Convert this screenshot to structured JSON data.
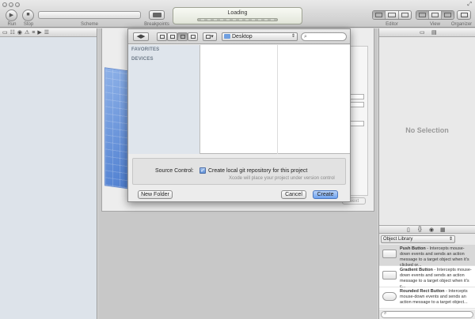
{
  "toolbar": {
    "run_label": "Run",
    "stop_label": "Stop",
    "scheme_label": "Scheme",
    "breakpoints_label": "Breakpoints",
    "activity_title": "Loading",
    "editor_label": "Editor",
    "view_label": "View",
    "organizer_label": "Organizer"
  },
  "dialog": {
    "location": "Desktop",
    "sidebar_favorites": "FAVORITES",
    "sidebar_devices": "DEVICES",
    "source_control_label": "Source Control:",
    "git_checkbox_label": "Create local git repository for this project",
    "git_checkbox_checked": true,
    "git_subtext": "Xcode will place your project under version control",
    "new_folder_button": "New Folder",
    "cancel_button": "Cancel",
    "create_button": "Create"
  },
  "background_sheet": {
    "next_button": "Next"
  },
  "utilities": {
    "inspector_empty": "No Selection",
    "library_select": "Object Library",
    "library_items": [
      {
        "name": "Push Button",
        "desc": " - Intercepts mouse-down events and sends an action message to a target object when it's clicked or..."
      },
      {
        "name": "Gradient Button",
        "desc": " - Intercepts mouse-down events and sends an action message to a target object when it's c..."
      },
      {
        "name": "Rounded Rect Button",
        "desc": " - Intercepts mouse-down events and sends an action message to a target object..."
      }
    ]
  },
  "colors": {
    "accent_blue": "#6ea2ef",
    "sidebar_bg": "#dfe5ec",
    "toolbar_bg": "#d6d6d6"
  }
}
